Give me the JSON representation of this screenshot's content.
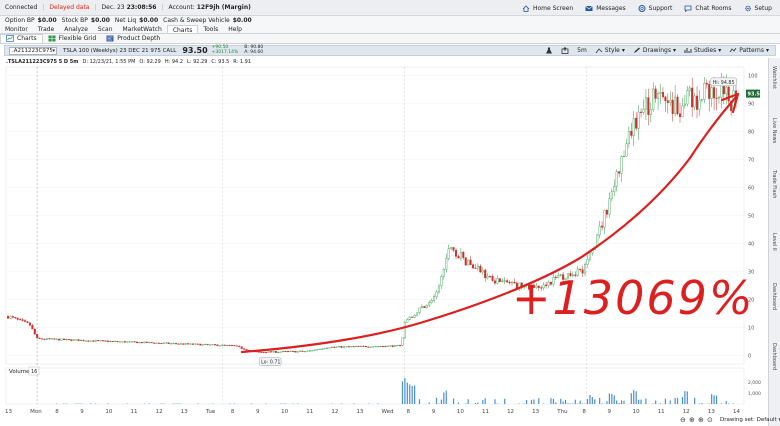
{
  "status_bar": {
    "connection": "Connected",
    "data_mode": "Delayed data",
    "datetime_label": "Dec. 23",
    "time": "23:08:56",
    "account_label": "Account:",
    "account_value": "12F9jh (Margin)",
    "right_links": [
      "Home Screen",
      "Messages",
      "Support",
      "Chat Rooms",
      "Setup"
    ]
  },
  "balances": [
    {
      "label": "Option BP",
      "value": "$0.00"
    },
    {
      "label": "Stock BP",
      "value": "$0.00"
    },
    {
      "label": "Net Liq",
      "value": "$0.00"
    },
    {
      "label": "Cash & Sweep Vehicle",
      "value": "$0.00"
    }
  ],
  "main_tabs": [
    "Monitor",
    "Trade",
    "Analyze",
    "Scan",
    "MarketWatch",
    "Charts",
    "Tools",
    "Help"
  ],
  "main_tab_active": "Charts",
  "sub_tabs": [
    "Charts",
    "Flexible Grid",
    "Product Depth"
  ],
  "toolbar": {
    "symbol": ".A211223C975",
    "description": "TSLA 100 (Weeklys) 23 DEC 21 975 CALL",
    "price": "93.50",
    "change_1": "+90.50",
    "change_2": "+3017.14%",
    "bid_label": "B: 90.80",
    "ask_label": "A: 94.60",
    "interval": "5m",
    "right_buttons": [
      "Style",
      "Drawings",
      "Studies",
      "Patterns"
    ]
  },
  "info_bar": {
    "symbol": ".TSLA211223C975 5 D 5m",
    "date": "D: 12/23/21, 1:55 PM",
    "open": "O: 92.29",
    "high": "H: 94.2",
    "low": "L: 92.29",
    "close": "C: 93.5",
    "range": "R: 1.91"
  },
  "annotation": {
    "text": "+13069%",
    "color": "#dc1f1f",
    "high_label": "Hi: 94.85",
    "low_label": "Lo: 0.71",
    "current_price_tag": "93.5"
  },
  "volume_panel": {
    "label": "Volume",
    "value": "16",
    "y_ticks": [
      "2,000",
      "1,000"
    ]
  },
  "x_axis_labels": [
    "13",
    "Mon",
    "8",
    "9",
    "10",
    "11",
    "12",
    "13",
    "Tue",
    "8",
    "9",
    "10",
    "11",
    "12",
    "13",
    "Wed",
    "8",
    "9",
    "10",
    "11",
    "12",
    "13",
    "Thu",
    "8",
    "9",
    "10",
    "11",
    "12",
    "13",
    "14"
  ],
  "right_panel_labels": [
    "Watchlist",
    "Live News",
    "Trade Flash",
    "Level II",
    "Dashboard",
    "Dashboard"
  ],
  "drawing_set": "Drawing set: Default",
  "colors": {
    "up_candle": "#2e9a49",
    "down_candle": "#c8302a",
    "volume_bar": "#4a8fd6",
    "price_tag_bg": "#1f6b35",
    "toolbar_bg": "#dfe6ee"
  },
  "chart_data": {
    "type": "candlestick",
    "title": "",
    "xlabel": "",
    "ylabel": "",
    "y_ticks": [
      0,
      10,
      20,
      30,
      40,
      50,
      60,
      70,
      80,
      90,
      100
    ],
    "ylim": [
      -3,
      103
    ],
    "days": [
      "Mon",
      "Tue",
      "Wed",
      "Thu"
    ],
    "close_anchors": [
      {
        "t": 0.0,
        "v": 14
      },
      {
        "t": 0.03,
        "v": 11
      },
      {
        "t": 0.04,
        "v": 6
      },
      {
        "t": 0.31,
        "v": 3.5
      },
      {
        "t": 0.34,
        "v": 1.2
      },
      {
        "t": 0.41,
        "v": 1.5
      },
      {
        "t": 0.44,
        "v": 3
      },
      {
        "t": 0.54,
        "v": 3.5
      },
      {
        "t": 0.545,
        "v": 12
      },
      {
        "t": 0.59,
        "v": 22
      },
      {
        "t": 0.605,
        "v": 40
      },
      {
        "t": 0.63,
        "v": 33
      },
      {
        "t": 0.67,
        "v": 27
      },
      {
        "t": 0.72,
        "v": 24
      },
      {
        "t": 0.79,
        "v": 31
      },
      {
        "t": 0.805,
        "v": 38
      },
      {
        "t": 0.83,
        "v": 59
      },
      {
        "t": 0.86,
        "v": 82
      },
      {
        "t": 0.885,
        "v": 92
      },
      {
        "t": 0.91,
        "v": 88
      },
      {
        "t": 0.945,
        "v": 92
      },
      {
        "t": 0.965,
        "v": 94.8
      },
      {
        "t": 0.99,
        "v": 91
      },
      {
        "t": 1.0,
        "v": 93.5
      }
    ],
    "volume_ylim": [
      0,
      2000
    ],
    "volume_spikes": [
      {
        "t": 0.545,
        "v": 2200
      },
      {
        "t": 0.555,
        "v": 1400
      },
      {
        "t": 0.6,
        "v": 600
      },
      {
        "t": 0.72,
        "v": 450
      },
      {
        "t": 0.8,
        "v": 700
      },
      {
        "t": 0.83,
        "v": 900
      },
      {
        "t": 0.86,
        "v": 1100
      },
      {
        "t": 0.93,
        "v": 650
      },
      {
        "t": 0.97,
        "v": 500
      }
    ]
  }
}
